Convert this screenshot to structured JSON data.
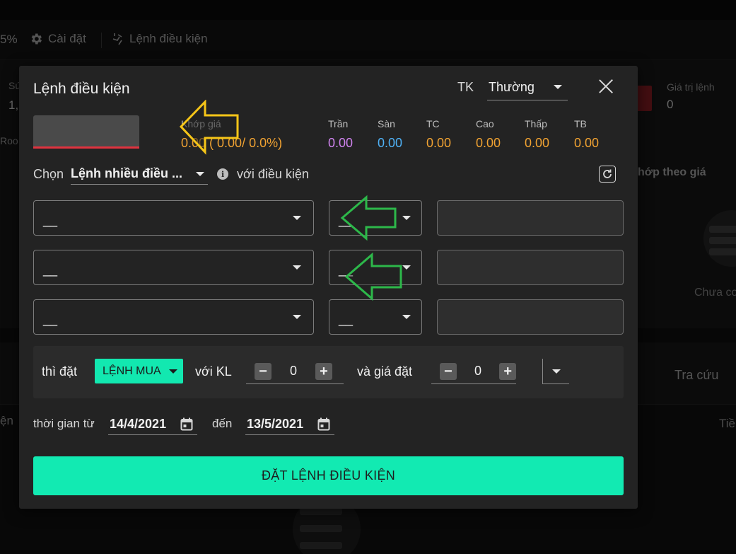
{
  "background": {
    "toolbar_partial_text": "5%",
    "settings_label": "Cài đặt",
    "conditional_order_label": "Lệnh điều kiện",
    "left_partial_1": "Sứ",
    "left_partial_2": "1,",
    "left_partial_3": "Roo",
    "left_partial_4": "ện",
    "order_value_label": "Giá trị lệnh",
    "order_value": "0",
    "match_by_price": "hớp theo giá",
    "empty_text": "Chưa cơ",
    "lookup_tab": "Tra cứu",
    "right_partial": "Tiề"
  },
  "dialog": {
    "title": "Lệnh điều kiện",
    "account_label": "TK",
    "account_value": "Thường",
    "price": {
      "label": "Khớp giá",
      "value": "0.00 ( 0.00/ 0.0%)"
    },
    "stats": [
      {
        "label": "Trần",
        "value": "0.00",
        "color": "#d083ef"
      },
      {
        "label": "Sàn",
        "value": "0.00",
        "color": "#4fb1f5"
      },
      {
        "label": "TC",
        "value": "0.00",
        "color": "#f0a232"
      },
      {
        "label": "Cao",
        "value": "0.00",
        "color": "#f0a232"
      },
      {
        "label": "Thấp",
        "value": "0.00",
        "color": "#f0a232"
      },
      {
        "label": "TB",
        "value": "0.00",
        "color": "#f0a232"
      }
    ],
    "choose_label": "Chọn",
    "order_type": "Lệnh nhiều điều ...",
    "with_condition": "với điều kiện",
    "conditions": [
      {
        "field": "__",
        "operator": "__",
        "value": ""
      },
      {
        "field": "__",
        "operator": "__",
        "value": ""
      },
      {
        "field": "__",
        "operator": "__",
        "value": ""
      }
    ],
    "action": {
      "then_place": "thì đặt",
      "side": "LỆNH MUA",
      "with_volume": "với KL",
      "volume": "0",
      "and_price": "và giá đặt",
      "price": "0"
    },
    "time": {
      "from_label": "thời gian từ",
      "from": "14/4/2021",
      "to_label": "đến",
      "to": "13/5/2021"
    },
    "submit": "ĐẶT LỆNH ĐIỀU KIỆN"
  },
  "colors": {
    "accent": "#12eab2",
    "price_orange": "#f0a232",
    "annotation_yellow": "#f5c518",
    "annotation_green": "#2db84a"
  }
}
